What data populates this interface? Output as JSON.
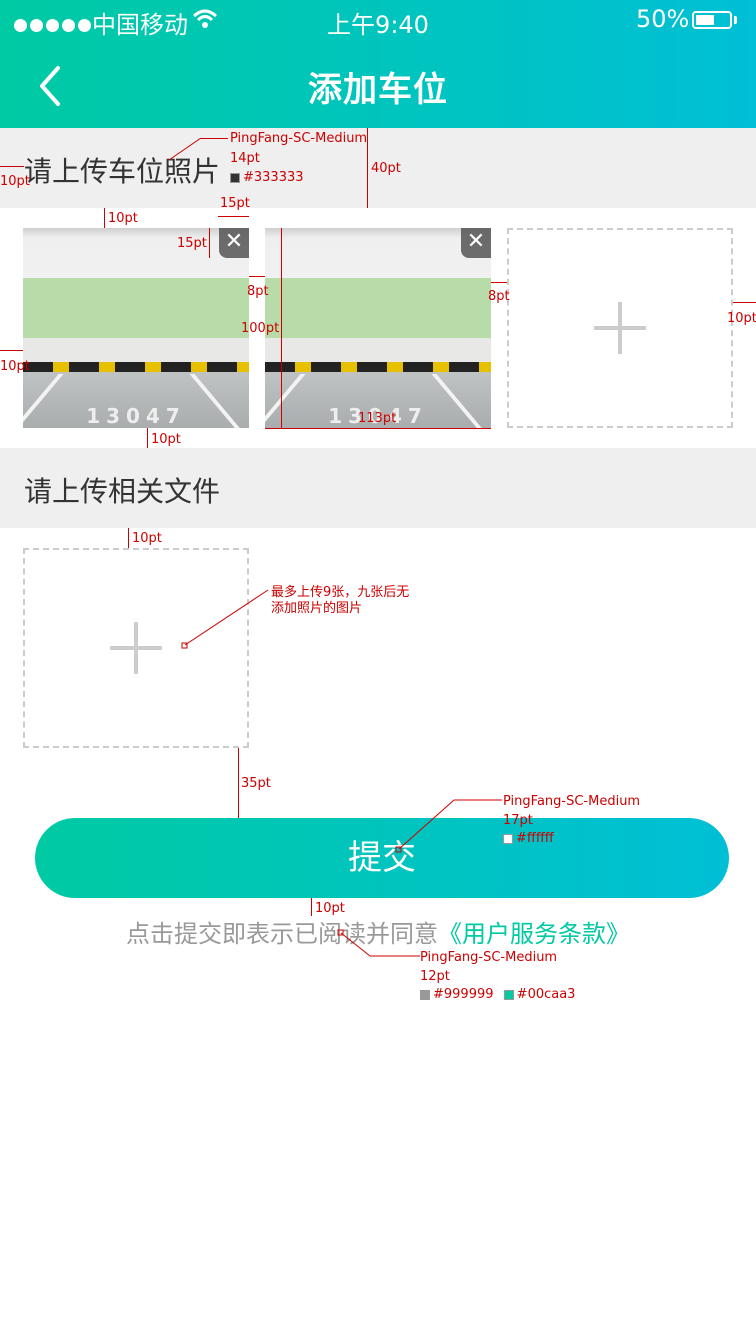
{
  "status_bar": {
    "carrier": "中国移动",
    "time": "上午9:40",
    "battery": "50%"
  },
  "nav": {
    "title": "添加车位",
    "back_icon": "chevron-left-icon"
  },
  "section_photos": {
    "heading": "请上传车位照片",
    "photos": [
      {
        "plate": "13047",
        "delete": "✕"
      },
      {
        "plate": "13047",
        "delete": "✕"
      }
    ]
  },
  "section_files": {
    "heading": "请上传相关文件"
  },
  "submit": {
    "label": "提交"
  },
  "agreement": {
    "text": "点击提交即表示已阅读并同意",
    "link": "《用户服务条款》"
  },
  "annotations": {
    "font_heading": "PingFang-SC-Medium",
    "size_heading": "14pt",
    "color_heading": "#333333",
    "m_40": "40pt",
    "m_10_left": "10pt",
    "m_10_top": "10pt",
    "m_15_w": "15pt",
    "m_15_h": "15pt",
    "m_8_a": "8pt",
    "m_8_b": "8pt",
    "m_100": "100pt",
    "m_10_right": "10pt",
    "m_10_left2": "10pt",
    "m_113": "113pt",
    "m_10_bottom": "10pt",
    "m_10_files": "10pt",
    "note_line1": "最多上传9张，九张后无",
    "note_line2": "添加照片的图片",
    "m_35": "35pt",
    "font_button": "PingFang-SC-Medium",
    "size_button": "17pt",
    "color_button": "#ffffff",
    "m_10_agree": "10pt",
    "font_agree": "PingFang-SC-Medium",
    "size_agree": "12pt",
    "color_agree_1": "#999999",
    "color_agree_2": "#00caa3"
  },
  "colors": {
    "brand_start": "#00caa3",
    "brand_end": "#00bfd6",
    "text_dark": "#333333",
    "text_gray": "#999999",
    "link": "#00caa3",
    "annotation": "#cc0000"
  }
}
